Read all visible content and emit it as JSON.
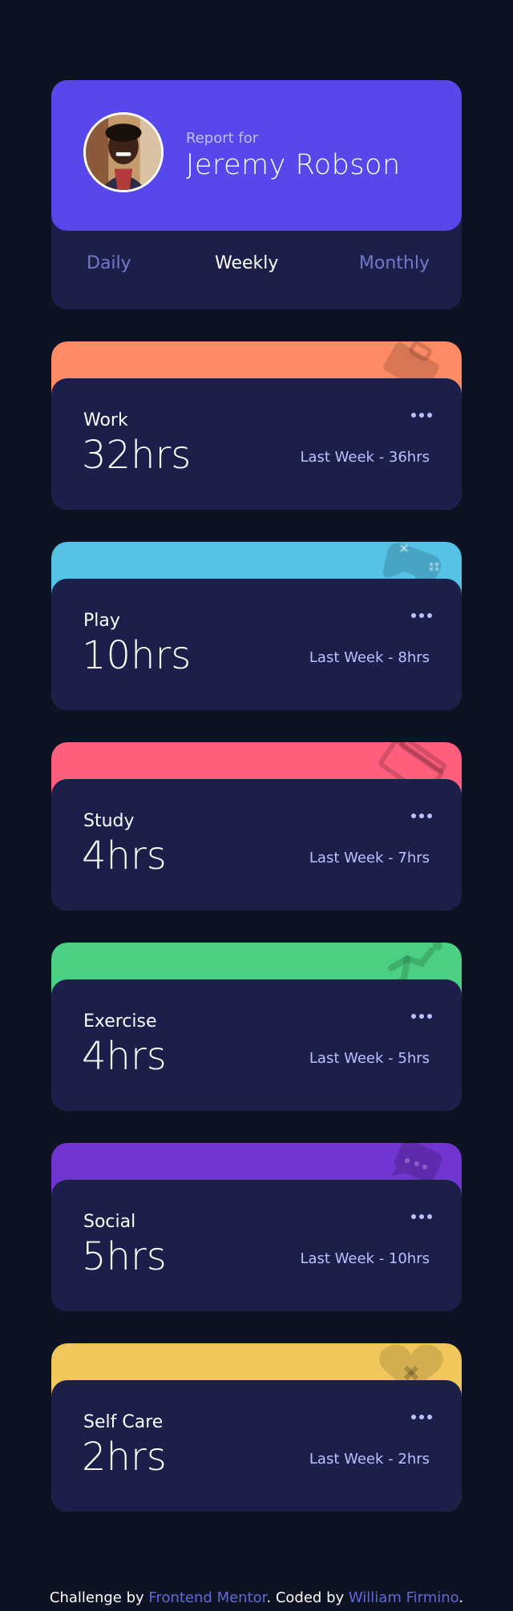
{
  "profile": {
    "report_for": "Report for",
    "name": "Jeremy Robson",
    "avatar_icon": "user-avatar"
  },
  "tabs": [
    {
      "label": "Daily",
      "active": false
    },
    {
      "label": "Weekly",
      "active": true
    },
    {
      "label": "Monthly",
      "active": false
    }
  ],
  "cards": [
    {
      "title": "Work",
      "hours": "32hrs",
      "previous": "Last Week - 36hrs",
      "color": "#ff8b64",
      "icon": "briefcase-icon"
    },
    {
      "title": "Play",
      "hours": "10hrs",
      "previous": "Last Week - 8hrs",
      "color": "#55c2e6",
      "icon": "gamepad-icon"
    },
    {
      "title": "Study",
      "hours": "4hrs",
      "previous": "Last Week - 7hrs",
      "color": "#ff5e7d",
      "icon": "book-icon"
    },
    {
      "title": "Exercise",
      "hours": "4hrs",
      "previous": "Last Week - 5hrs",
      "color": "#4bcf82",
      "icon": "running-icon"
    },
    {
      "title": "Social",
      "hours": "5hrs",
      "previous": "Last Week - 10hrs",
      "color": "#7335d2",
      "icon": "chat-icon"
    },
    {
      "title": "Self Care",
      "hours": "2hrs",
      "previous": "Last Week - 2hrs",
      "color": "#f1c75b",
      "icon": "heart-icon"
    }
  ],
  "footer": {
    "prefix": "Challenge by ",
    "link1": "Frontend Mentor",
    "middle": ". Coded by ",
    "link2": "William Firmino",
    "suffix": "."
  }
}
